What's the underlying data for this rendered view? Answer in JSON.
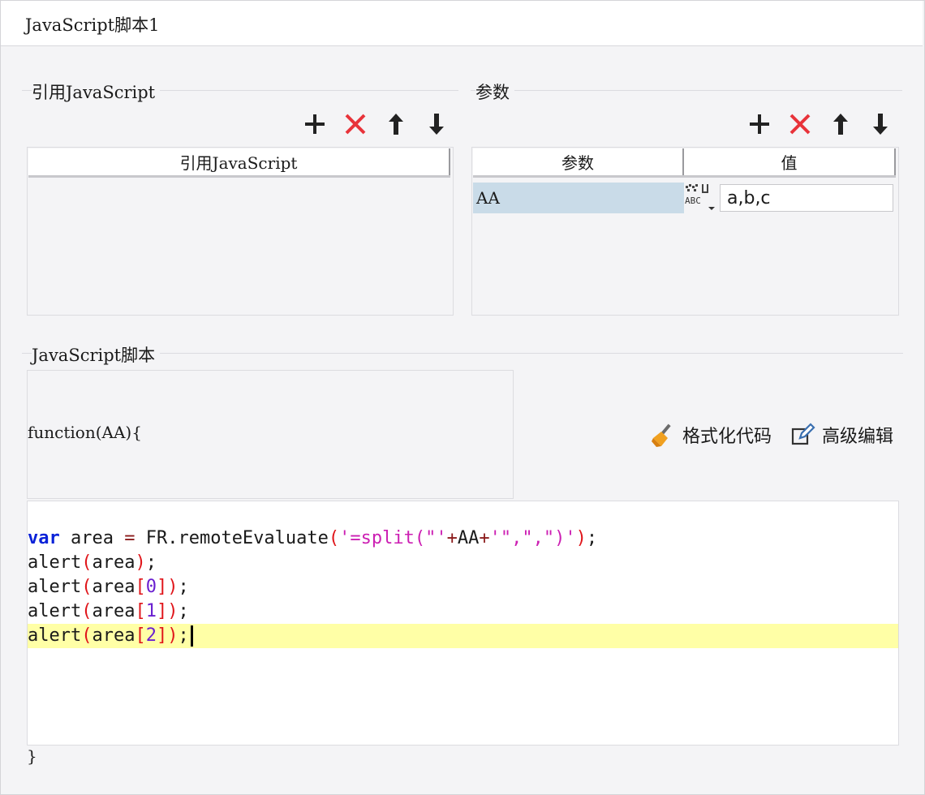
{
  "window": {
    "title": "JavaScript脚本1"
  },
  "refs": {
    "legend": "引用JavaScript",
    "column_header": "引用JavaScript",
    "rows": []
  },
  "params": {
    "legend": "参数",
    "columns": [
      "参数",
      "值"
    ],
    "rows": [
      {
        "name": "AA",
        "value_type_icon": "abc-text-type-icon",
        "value": "a,b,c"
      }
    ]
  },
  "toolbar_icons": [
    "plus-icon",
    "delete-x-icon",
    "arrow-up-icon",
    "arrow-down-icon"
  ],
  "script": {
    "legend": "JavaScript脚本",
    "function_header": "function(AA){",
    "closing": "}",
    "format_label": "格式化代码",
    "advanced_label": "高级编辑",
    "code": {
      "l1": {
        "kw": "var",
        "id1": " area ",
        "op1": "=",
        "id2": " FR.remoteEvaluate",
        "p1": "(",
        "s1": "'=split(\"'",
        "op2": "+",
        "id3": "AA",
        "op3": "+",
        "s2": "'\",\",\")'",
        "p2": ")",
        "end": ";"
      },
      "l2": {
        "id": "alert",
        "p1": "(",
        "arg": "area",
        "p2": ")",
        "end": ";"
      },
      "l3": {
        "id": "alert",
        "p1": "(",
        "arg": "area",
        "b1": "[",
        "n": "0",
        "b2": "]",
        "p2": ")",
        "end": ";"
      },
      "l4": {
        "id": "alert",
        "p1": "(",
        "arg": "area",
        "b1": "[",
        "n": "1",
        "b2": "]",
        "p2": ")",
        "end": ";"
      },
      "l5": {
        "id": "alert",
        "p1": "(",
        "arg": "area",
        "b1": "[",
        "n": "2",
        "b2": "]",
        "p2": ")",
        "end": ";"
      }
    }
  },
  "colors": {
    "keyword": "#0a22d8",
    "string": "#cc1fb3",
    "paren": "#e0151a",
    "number": "#6a1fd0",
    "current_line": "#ffffa6",
    "selected_row": "#c9dbe8",
    "delete_icon": "#e8333a"
  }
}
